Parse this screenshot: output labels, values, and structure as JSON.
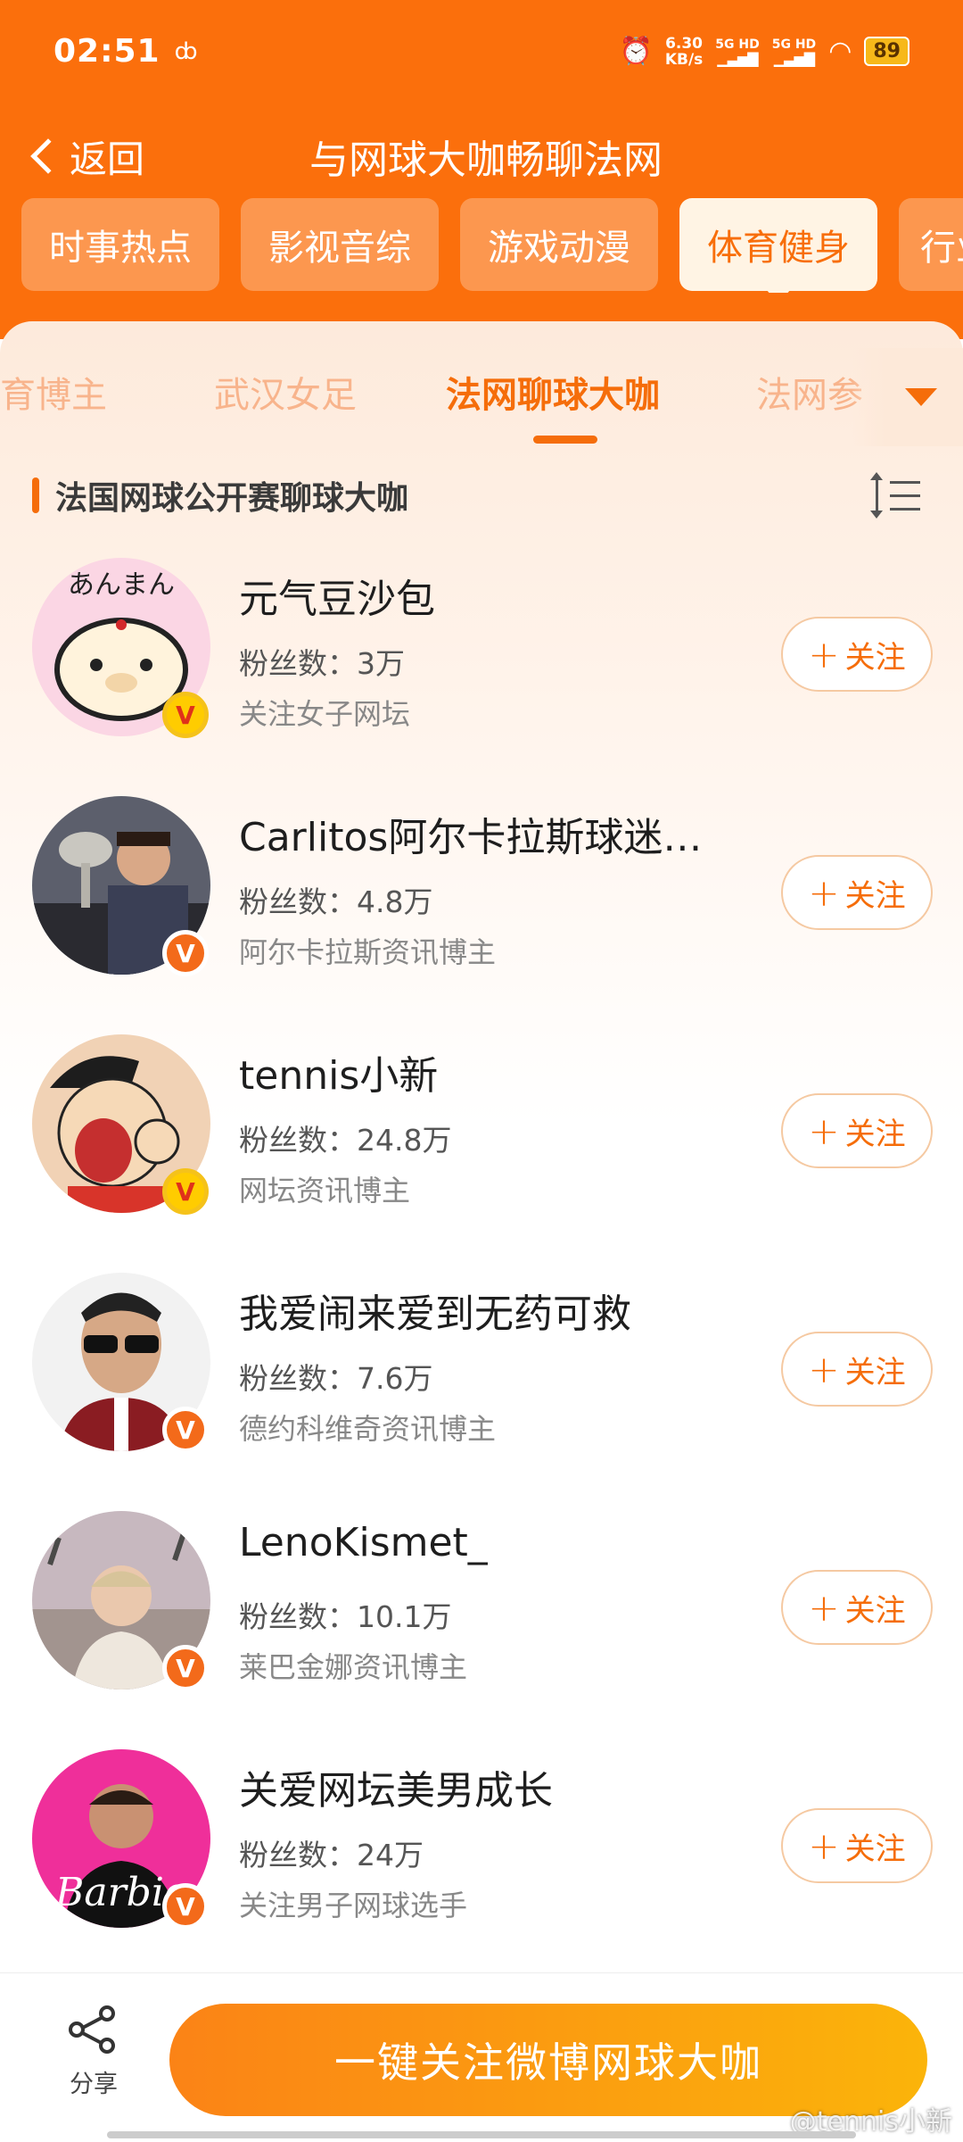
{
  "status_bar": {
    "time": "02:51",
    "net_speed_value": "6.30",
    "net_speed_unit": "KB/s",
    "signal1": "5G HD",
    "signal2": "5G HD",
    "battery": "89"
  },
  "header": {
    "back_label": "返回",
    "title": "与网球大咖畅聊法网"
  },
  "category_tabs": [
    {
      "label": "时事热点",
      "active": false
    },
    {
      "label": "影视音综",
      "active": false
    },
    {
      "label": "游戏动漫",
      "active": false
    },
    {
      "label": "体育健身",
      "active": true
    },
    {
      "label": "行业",
      "active": false
    }
  ],
  "sub_tabs": [
    {
      "label": "育博主",
      "active": false
    },
    {
      "label": "武汉女足",
      "active": false
    },
    {
      "label": "法网聊球大咖",
      "active": true
    },
    {
      "label": "法网参",
      "active": false
    }
  ],
  "section": {
    "title": "法国网球公开赛聊球大咖"
  },
  "users": [
    {
      "name": "元气豆沙包",
      "fans": "粉丝数：3万",
      "desc": "关注女子网坛",
      "badge": "gold",
      "follow": "关注"
    },
    {
      "name": "Carlitos阿尔卡拉斯球迷…",
      "fans": "粉丝数：4.8万",
      "desc": "阿尔卡拉斯资讯博主",
      "badge": "orange",
      "follow": "关注"
    },
    {
      "name": "tennis小新",
      "fans": "粉丝数：24.8万",
      "desc": "网坛资讯博主",
      "badge": "gold",
      "follow": "关注"
    },
    {
      "name": "我爱闹来爱到无药可救",
      "fans": "粉丝数：7.6万",
      "desc": "德约科维奇资讯博主",
      "badge": "orange",
      "follow": "关注"
    },
    {
      "name": "LenoKismet_",
      "fans": "粉丝数：10.1万",
      "desc": "莱巴金娜资讯博主",
      "badge": "orange",
      "follow": "关注"
    },
    {
      "name": "关爱网坛美男成长",
      "fans": "粉丝数：24万",
      "desc": "关注男子网球选手",
      "badge": "orange",
      "follow": "关注"
    }
  ],
  "bottom_bar": {
    "share_label": "分享",
    "follow_all_label": "一键关注微博网球大咖"
  },
  "watermark": "@tennis小新",
  "colors": {
    "brand_orange": "#fb6f0c",
    "accent": "#f56d0a"
  }
}
